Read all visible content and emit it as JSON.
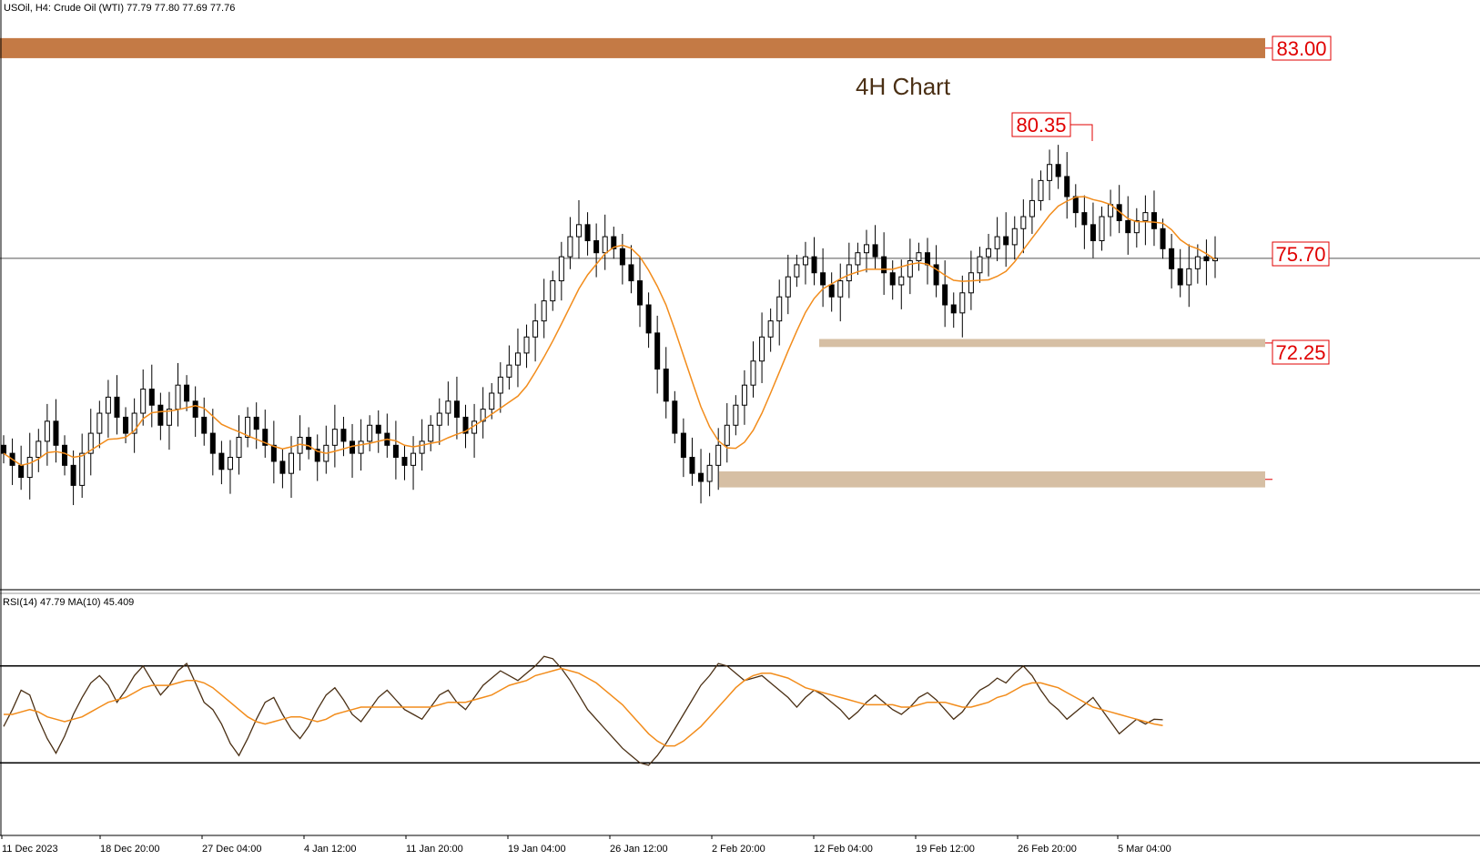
{
  "header": {
    "symbol_info": "USOil, H4:  Crude Oil (WTI)  77.79 77.80 77.69 77.76",
    "chart_title": "4H Chart"
  },
  "colors": {
    "candle": "#000000",
    "ma_line": "#f28c1b",
    "rsi_line": "#4a2f14",
    "rsi_ma_line": "#f28c1b",
    "resistance_zone": "#c47a45",
    "support_zone": "#d6bfa4",
    "label_text": "#e00000",
    "label_border": "#e00000",
    "current_price_line": "#555555"
  },
  "price_labels": {
    "resistance": "83.00",
    "swing_high": "80.35",
    "support_1": "75.70",
    "support_2": "72.25"
  },
  "rsi_panel": {
    "label": "RSI(14) 47.79 MA(10) 45.409",
    "upper_level": 70,
    "lower_level": 30
  },
  "chart_data": {
    "type": "candlestick",
    "symbol": "USOil",
    "timeframe": "H4",
    "ohlc_last": {
      "open": 77.79,
      "high": 77.8,
      "low": 77.69,
      "close": 77.76
    },
    "ylim": [
      69.5,
      84.2
    ],
    "zones": [
      {
        "name": "83.00",
        "low": 82.75,
        "high": 83.25,
        "kind": "resistance"
      },
      {
        "name": "75.70",
        "low": 75.55,
        "high": 75.75,
        "kind": "support"
      },
      {
        "name": "72.25",
        "low": 72.05,
        "high": 72.45,
        "kind": "support"
      }
    ],
    "annotated_high": 80.35,
    "current_price": 77.76,
    "x_ticks": [
      "11 Dec 2023",
      "18 Dec 20:00",
      "27 Dec 04:00",
      "4 Jan 12:00",
      "11 Jan 20:00",
      "19 Jan 04:00",
      "26 Jan 12:00",
      "2 Feb 20:00",
      "12 Feb 04:00",
      "19 Feb 12:00",
      "26 Feb 20:00",
      "5 Mar 04:00"
    ],
    "close_series": [
      72.9,
      72.6,
      72.3,
      72.8,
      73.2,
      73.7,
      73.1,
      72.6,
      72.1,
      72.9,
      73.4,
      73.9,
      74.3,
      73.8,
      73.4,
      73.9,
      74.5,
      74.1,
      73.6,
      74.0,
      74.6,
      74.2,
      73.8,
      73.4,
      72.9,
      72.5,
      72.8,
      73.3,
      73.8,
      73.5,
      73.1,
      72.7,
      72.4,
      72.9,
      73.3,
      73.0,
      72.7,
      73.1,
      73.5,
      73.2,
      72.9,
      73.2,
      73.6,
      73.4,
      73.1,
      72.8,
      72.6,
      72.9,
      73.2,
      73.6,
      73.9,
      74.2,
      73.8,
      73.4,
      73.7,
      74.0,
      74.4,
      74.8,
      75.1,
      75.4,
      75.8,
      76.2,
      76.7,
      77.2,
      77.8,
      78.3,
      78.6,
      78.2,
      77.9,
      78.3,
      78.0,
      77.6,
      77.2,
      76.6,
      75.9,
      75.0,
      74.2,
      73.4,
      72.8,
      72.4,
      72.2,
      72.6,
      73.1,
      73.6,
      74.1,
      74.6,
      75.2,
      75.8,
      76.2,
      76.8,
      77.3,
      77.6,
      77.8,
      77.4,
      77.1,
      76.8,
      77.2,
      77.6,
      77.9,
      78.1,
      77.8,
      77.4,
      77.1,
      77.3,
      77.7,
      77.9,
      77.6,
      77.1,
      76.6,
      76.4,
      76.9,
      77.4,
      77.8,
      78.0,
      78.3,
      78.1,
      78.5,
      78.8,
      79.2,
      79.7,
      80.1,
      79.8,
      79.3,
      78.9,
      78.6,
      78.2,
      78.8,
      79.1,
      78.7,
      78.4,
      78.7,
      78.9,
      78.5,
      78.0,
      77.5,
      77.1,
      77.5,
      77.8,
      77.7,
      77.76
    ],
    "ma_period_label": "",
    "rsi": {
      "period": 14,
      "value": 47.79,
      "ma_period": 10,
      "ma_value": 45.409,
      "levels": [
        70,
        30
      ],
      "ylim": [
        0,
        100
      ],
      "values": [
        45,
        52,
        60,
        58,
        48,
        40,
        34,
        41,
        50,
        57,
        63,
        66,
        62,
        55,
        60,
        66,
        70,
        64,
        58,
        62,
        68,
        71,
        63,
        55,
        52,
        46,
        38,
        33,
        40,
        48,
        55,
        57,
        50,
        44,
        40,
        45,
        52,
        58,
        61,
        56,
        50,
        47,
        52,
        57,
        60,
        56,
        52,
        50,
        48,
        53,
        58,
        60,
        55,
        52,
        57,
        62,
        65,
        68,
        66,
        64,
        67,
        70,
        74,
        73,
        69,
        64,
        58,
        52,
        48,
        44,
        40,
        36,
        33,
        30,
        29,
        33,
        38,
        44,
        50,
        56,
        62,
        66,
        71,
        70,
        67,
        64,
        65,
        66,
        63,
        60,
        57,
        53,
        57,
        60,
        58,
        55,
        52,
        48,
        51,
        55,
        58,
        55,
        52,
        50,
        53,
        57,
        59,
        56,
        52,
        48,
        51,
        56,
        60,
        62,
        65,
        63,
        67,
        70,
        66,
        60,
        55,
        52,
        48,
        51,
        54,
        57,
        52,
        47,
        42,
        45,
        48,
        46,
        48,
        47.79
      ],
      "ma_values": [
        50,
        50,
        51,
        52,
        51,
        49,
        48,
        47,
        48,
        49,
        51,
        53,
        55,
        56,
        57,
        59,
        61,
        62,
        62,
        62,
        63,
        64,
        64,
        63,
        61,
        58,
        55,
        52,
        49,
        47,
        46,
        47,
        48,
        49,
        49,
        48,
        47,
        48,
        50,
        51,
        52,
        53,
        53,
        53,
        53,
        53,
        53,
        53,
        53,
        53,
        54,
        55,
        55,
        55,
        56,
        57,
        58,
        60,
        62,
        63,
        64,
        66,
        67,
        68,
        69,
        68,
        67,
        65,
        63,
        60,
        57,
        54,
        50,
        46,
        42,
        39,
        37,
        37,
        39,
        42,
        45,
        49,
        53,
        57,
        61,
        64,
        66,
        67,
        67,
        66,
        65,
        63,
        61,
        60,
        59,
        58,
        57,
        56,
        55,
        54,
        54,
        54,
        54,
        53,
        53,
        54,
        55,
        55,
        55,
        54,
        53,
        53,
        54,
        55,
        57,
        58,
        60,
        62,
        63,
        63,
        62,
        61,
        59,
        57,
        55,
        53,
        52,
        51,
        50,
        49,
        48,
        47,
        46,
        45.409
      ]
    }
  }
}
